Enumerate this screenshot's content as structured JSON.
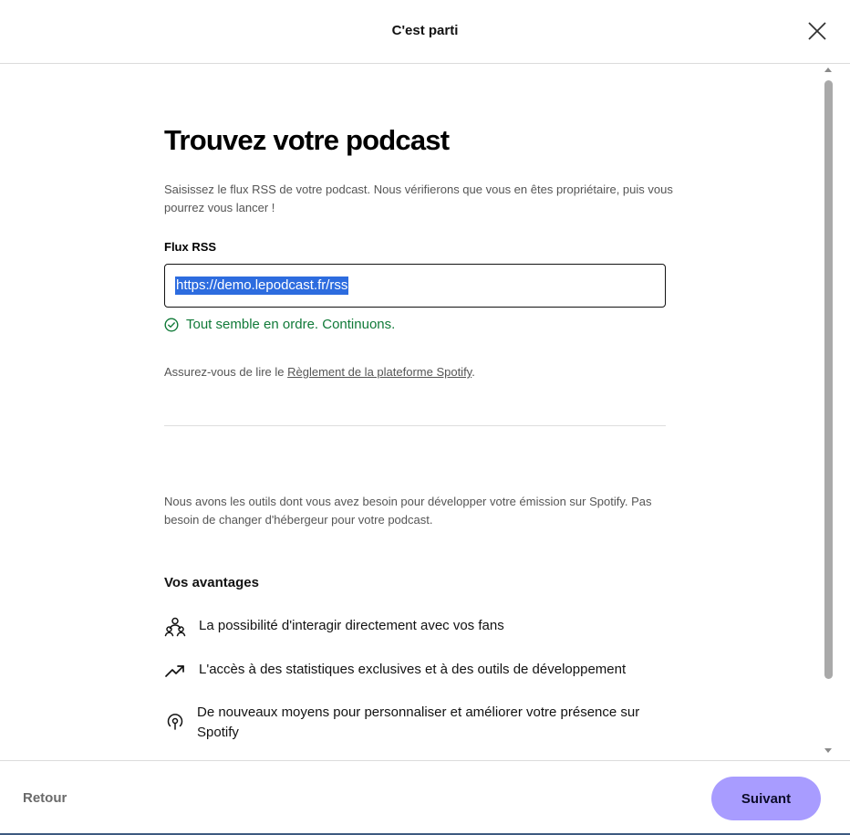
{
  "header": {
    "title": "C'est parti",
    "close_icon": "close-icon"
  },
  "main": {
    "title": "Trouvez votre podcast",
    "intro": "Saisissez le flux RSS de votre podcast. Nous vérifierons que vous en êtes propriétaire, puis vous pourrez vous lancer !",
    "rss_label": "Flux RSS",
    "rss_value": "https://demo.lepodcast.fr/rss",
    "success_icon": "check-circle-icon",
    "success_message": "Tout semble en ordre. Continuons.",
    "policy_prefix": "Assurez-vous de lire le ",
    "policy_link": "Règlement de la plateforme Spotify",
    "policy_suffix": ".",
    "tools_text": "Nous avons les outils dont vous avez besoin pour développer votre émission sur Spotify. Pas besoin de changer d'hébergeur pour votre podcast.",
    "benefits_heading": "Vos avantages",
    "benefits": [
      {
        "icon": "people-icon",
        "text": "La possibilité d'interagir directement avec vos fans"
      },
      {
        "icon": "trending-up-icon",
        "text": "L'accès à des statistiques exclusives et à des outils de développement"
      },
      {
        "icon": "podcast-icon",
        "text": "De nouveaux moyens pour personnaliser et améliorer votre présence sur Spotify"
      }
    ]
  },
  "footer": {
    "back_label": "Retour",
    "next_label": "Suivant"
  },
  "colors": {
    "accent": "#a89cff",
    "success": "#107a38",
    "selection": "#2d6cdf"
  }
}
